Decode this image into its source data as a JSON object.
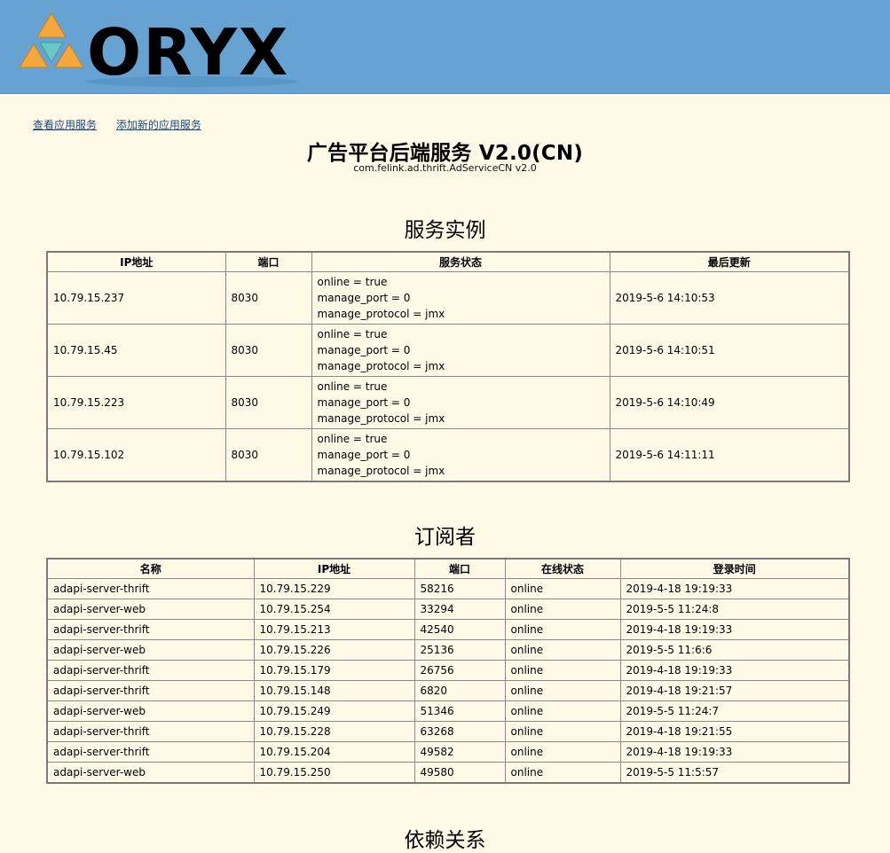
{
  "header": {
    "logo_text": "ORYX"
  },
  "nav": {
    "view_services": "查看应用服务",
    "add_service": "添加新的应用服务"
  },
  "service": {
    "title": "广告平台后端服务 V2.0(CN)",
    "subtitle": "com.felink.ad.thrift.AdServiceCN v2.0"
  },
  "instances": {
    "heading": "服务实例",
    "columns": [
      "IP地址",
      "端口",
      "服务状态",
      "最后更新"
    ],
    "rows": [
      {
        "ip": "10.79.15.237",
        "port": "8030",
        "status": [
          "online = true",
          "manage_port = 0",
          "manage_protocol = jmx"
        ],
        "updated": "2019-5-6 14:10:53"
      },
      {
        "ip": "10.79.15.45",
        "port": "8030",
        "status": [
          "online = true",
          "manage_port = 0",
          "manage_protocol = jmx"
        ],
        "updated": "2019-5-6 14:10:51"
      },
      {
        "ip": "10.79.15.223",
        "port": "8030",
        "status": [
          "online = true",
          "manage_port = 0",
          "manage_protocol = jmx"
        ],
        "updated": "2019-5-6 14:10:49"
      },
      {
        "ip": "10.79.15.102",
        "port": "8030",
        "status": [
          "online = true",
          "manage_port = 0",
          "manage_protocol = jmx"
        ],
        "updated": "2019-5-6 14:11:11"
      }
    ]
  },
  "subscribers": {
    "heading": "订阅者",
    "columns": [
      "名称",
      "IP地址",
      "端口",
      "在线状态",
      "登录时间"
    ],
    "rows": [
      [
        "adapi-server-thrift",
        "10.79.15.229",
        "58216",
        "online",
        "2019-4-18 19:19:33"
      ],
      [
        "adapi-server-web",
        "10.79.15.254",
        "33294",
        "online",
        "2019-5-5 11:24:8"
      ],
      [
        "adapi-server-thrift",
        "10.79.15.213",
        "42540",
        "online",
        "2019-4-18 19:19:33"
      ],
      [
        "adapi-server-web",
        "10.79.15.226",
        "25136",
        "online",
        "2019-5-5 11:6:6"
      ],
      [
        "adapi-server-thrift",
        "10.79.15.179",
        "26756",
        "online",
        "2019-4-18 19:19:33"
      ],
      [
        "adapi-server-thrift",
        "10.79.15.148",
        "6820",
        "online",
        "2019-4-18 19:21:57"
      ],
      [
        "adapi-server-web",
        "10.79.15.249",
        "51346",
        "online",
        "2019-5-5 11:24:7"
      ],
      [
        "adapi-server-thrift",
        "10.79.15.228",
        "63268",
        "online",
        "2019-4-18 19:21:55"
      ],
      [
        "adapi-server-thrift",
        "10.79.15.204",
        "49582",
        "online",
        "2019-4-18 19:19:33"
      ],
      [
        "adapi-server-web",
        "10.79.15.250",
        "49580",
        "online",
        "2019-5-5 11:5:57"
      ]
    ]
  },
  "dependencies": {
    "heading": "依赖关系"
  }
}
